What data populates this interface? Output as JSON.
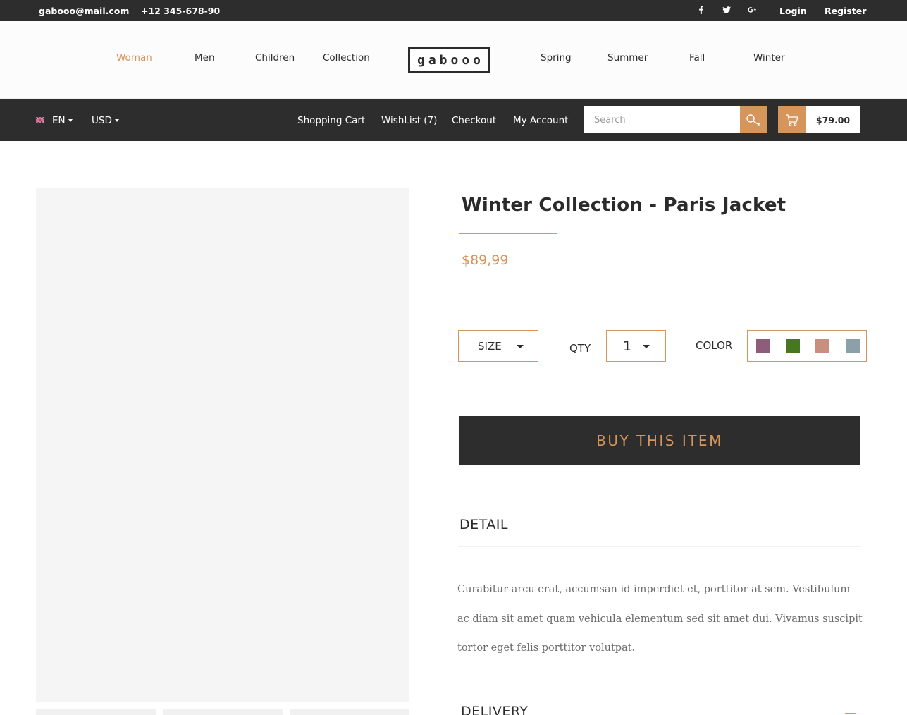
{
  "topbar": {
    "email": "gabooo@mail.com",
    "phone": "+12 345-678-90",
    "social": [
      "facebook-icon",
      "twitter-icon",
      "google-plus-icon"
    ],
    "login": "Login",
    "register": "Register"
  },
  "nav": {
    "left": [
      "Woman",
      "Men",
      "Children",
      "Collection"
    ],
    "logo": "gabooo",
    "right": [
      "Spring",
      "Summer",
      "Fall",
      "Winter"
    ],
    "active": "Woman"
  },
  "subbar": {
    "language": "EN",
    "currency": "USD",
    "links": [
      "Shopping Cart",
      "WishList (7)",
      "Checkout",
      "My Account"
    ],
    "search_placeholder": "Search",
    "cart_total": "$79.00"
  },
  "product": {
    "title": "Winter Collection - Paris Jacket",
    "price": "$89,99",
    "size_label": "SIZE",
    "qty_label": "QTY",
    "qty_value": "1",
    "color_label": "COLOR",
    "colors": [
      "#8d5d7b",
      "#47771e",
      "#c88f7f",
      "#8ca0aa"
    ],
    "buy_label": "BUY THIS ITEM"
  },
  "accordion": {
    "detail_title": "DETAIL",
    "detail_text": "Curabitur arcu erat, accumsan id imperdiet et, porttitor at sem. Vestibulum ac diam sit amet quam vehicula elementum sed sit amet dui. Vivamus suscipit tortor eget felis porttitor volutpat.",
    "delivery_title": "DELIVERY"
  },
  "colors": {
    "accent": "#d5955b",
    "dark": "#2d2d2d"
  }
}
